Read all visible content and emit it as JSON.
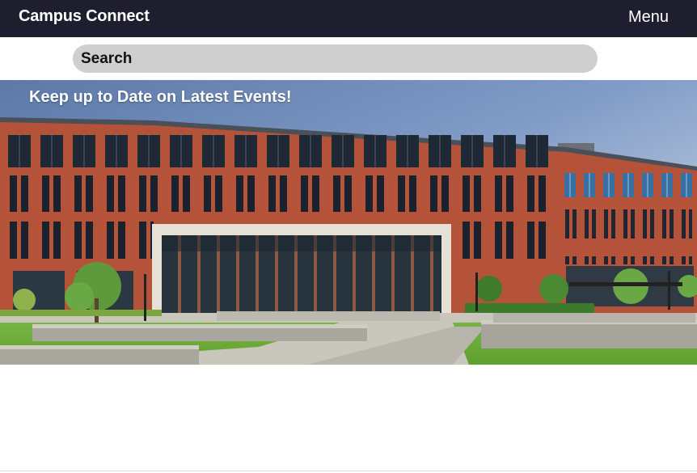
{
  "navbar": {
    "brand": "Campus Connect",
    "menu_label": "Menu"
  },
  "search": {
    "placeholder": "Search"
  },
  "hero": {
    "caption": "Keep up to Date on Latest Events!",
    "image_subject": "campus-building-photo"
  },
  "colors": {
    "navbar_bg": "#1f1e2e",
    "search_bg": "#cfcfcf",
    "brick": "#b5533a"
  }
}
